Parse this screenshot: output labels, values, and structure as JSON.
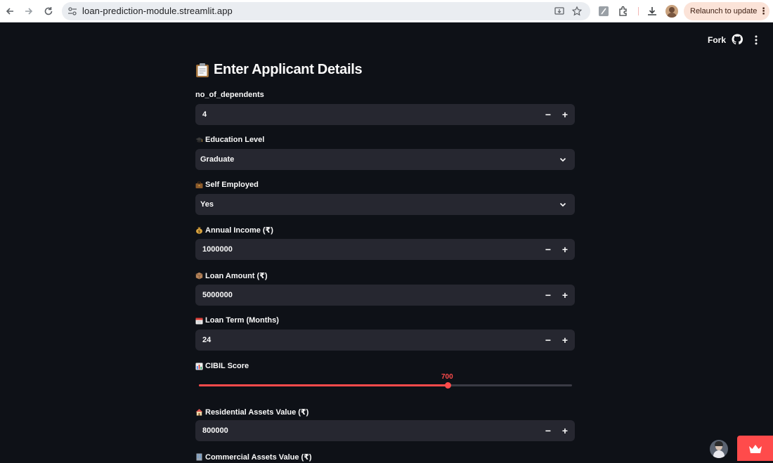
{
  "browser": {
    "url": "loan-prediction-module.streamlit.app",
    "relaunch_label": "Relaunch to update"
  },
  "header": {
    "fork_label": "Fork"
  },
  "page": {
    "title": "Enter Applicant Details"
  },
  "fields": {
    "dependents": {
      "label": "no_of_dependents",
      "value": "4"
    },
    "education": {
      "label": "Education Level",
      "value": "Graduate"
    },
    "self_employed": {
      "label": "Self Employed",
      "value": "Yes"
    },
    "income": {
      "label": "Annual Income (₹)",
      "value": "1000000"
    },
    "loan_amount": {
      "label": "Loan Amount (₹)",
      "value": "5000000"
    },
    "loan_term": {
      "label": "Loan Term (Months)",
      "value": "24"
    },
    "cibil": {
      "label": "CIBIL Score",
      "value": "700",
      "fill_fraction": 0.667
    },
    "residential": {
      "label": "Residential Assets Value (₹)",
      "value": "800000"
    },
    "commercial": {
      "label": "Commercial Assets Value (₹)"
    }
  },
  "colors": {
    "background": "#0e1117",
    "input_bg": "#262730",
    "accent": "#ff4b4b"
  },
  "stepper": {
    "minus": "−",
    "plus": "+"
  }
}
